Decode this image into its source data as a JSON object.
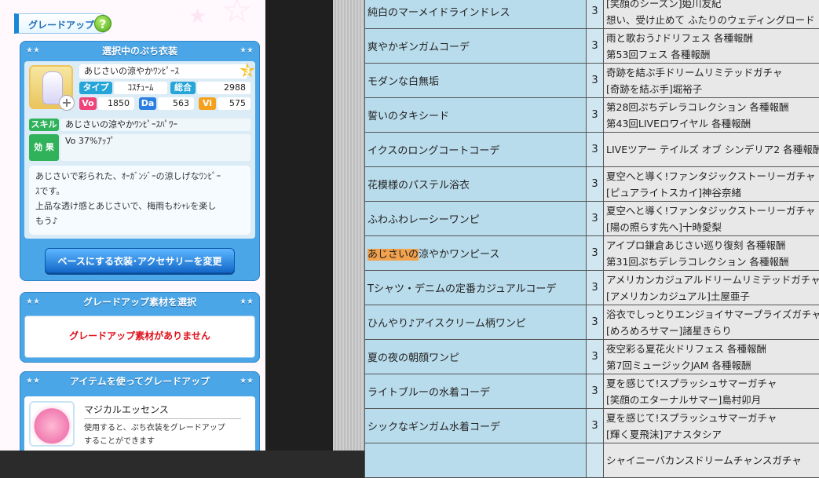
{
  "left_panel": {
    "header": {
      "title": "グレードアップ",
      "help_icon": "question-icon"
    },
    "selected": {
      "section_title": "選択中のぷち衣装",
      "name": "あじさいの涼やかﾜﾝﾋﾟｰｽ",
      "rank": "3",
      "type_label": "タイプ",
      "type_value": "ｺｽﾁｭｰﾑ",
      "total_label": "総合",
      "total_value": "2988",
      "vo_label": "Vo",
      "vo_value": "1850",
      "da_label": "Da",
      "da_value": "563",
      "vi_label": "Vi",
      "vi_value": "575",
      "skill_label": "スキル",
      "skill_value": "あじさいの涼やかﾜﾝﾋﾟｰｽﾊﾟﾜｰ",
      "effect_label": "効 果",
      "effect_value": "Vo 37%ｱｯﾌﾟ",
      "description_line1": "あじさいで彩られた、ｵｰｶﾞﾝｼﾞｰの涼しげなﾜﾝﾋﾟｰ",
      "description_line2": "ｽです。",
      "description_line3": "上品な透け感とあじさいで、梅雨もｵｼｬﾚを楽し",
      "description_line4": "もう♪",
      "change_button": "ベースにする衣装･アクセサリーを変更"
    },
    "material": {
      "section_title": "グレードアップ素材を選択",
      "empty_message": "グレードアップ素材がありません"
    },
    "item": {
      "section_title": "アイテムを使ってグレードアップ",
      "name": "マジカルエッセンス",
      "desc_line1": "使用すると、ぷち衣装をグレードアップ",
      "desc_line2": "することができます"
    }
  },
  "table": {
    "rows": [
      {
        "name": "純白のマーメイドラインドレス",
        "rarity": "3",
        "src1": "[笑顔のシーズン]姫川友紀",
        "src2": "想い、受け止めて ふたりのウェディングロード"
      },
      {
        "name": "爽やかギンガムコーデ",
        "rarity": "3",
        "src1": "雨と歌おう♪ドリフェス 各種報酬",
        "src2": "第53回フェス 各種報酬"
      },
      {
        "name": "モダンな白無垢",
        "rarity": "3",
        "src1": "奇跡を結ぶ手ドリームリミテッドガチャ",
        "src2": "[奇跡を結ぶ手]堀裕子"
      },
      {
        "name": "誓いのタキシード",
        "rarity": "3",
        "src1": "第28回ぷちデレラコレクション 各種報酬",
        "src2": "第43回LIVEロワイヤル 各種報酬"
      },
      {
        "name": "イクスのロングコートコーデ",
        "rarity": "3",
        "src1": "LIVEツアー テイルズ オブ シンデリア2 各種報酬",
        "src2": ""
      },
      {
        "name": "花模様のパステル浴衣",
        "rarity": "3",
        "src1": "夏空へと導く!ファンタジックストーリーガチャ",
        "src2": "[ピュアライトスカイ]神谷奈緒"
      },
      {
        "name": "ふわふわレーシーワンピ",
        "rarity": "3",
        "src1": "夏空へと導く!ファンタジックストーリーガチャ",
        "src2": "[陽の照らす先へ]十時愛梨"
      },
      {
        "name_hl": "あじさいの",
        "name_rest": "涼やかワンピース",
        "rarity": "3",
        "src1": "アイプロ鎌倉あじさい巡り復刻 各種報酬",
        "src2": "第31回ぷちデレラコレクション 各種報酬"
      },
      {
        "name": "Tシャツ・デニムの定番カジュアルコーデ",
        "rarity": "3",
        "src1": "アメリカンカジュアルドリームリミテッドガチャ",
        "src2": "[アメリカンカジュアル]土屋亜子"
      },
      {
        "name": "ひんやり♪アイスクリーム柄ワンピ",
        "rarity": "3",
        "src1": "浴衣でしっとりエンジョイサマープライズガチャ",
        "src2": "[めろめろサマー]諸星きらり"
      },
      {
        "name": "夏の夜の朝顔ワンピ",
        "rarity": "3",
        "src1": "夜空彩る夏花火ドリフェス 各種報酬",
        "src2": "第7回ミュージックJAM 各種報酬"
      },
      {
        "name": "ライトブルーの水着コーデ",
        "rarity": "3",
        "src1": "夏を感じて!スプラッシュサマーガチャ",
        "src2": "[笑顔のエターナルサマー]島村卯月"
      },
      {
        "name": "シックなギンガム水着コーデ",
        "rarity": "3",
        "src1": "夏を感じて!スプラッシュサマーガチャ",
        "src2": "[輝く夏飛沫]アナスタシア"
      },
      {
        "name": "",
        "rarity": "",
        "src1": "シャイニーバカンスドリームチャンスガチャ",
        "src2": ""
      }
    ]
  }
}
